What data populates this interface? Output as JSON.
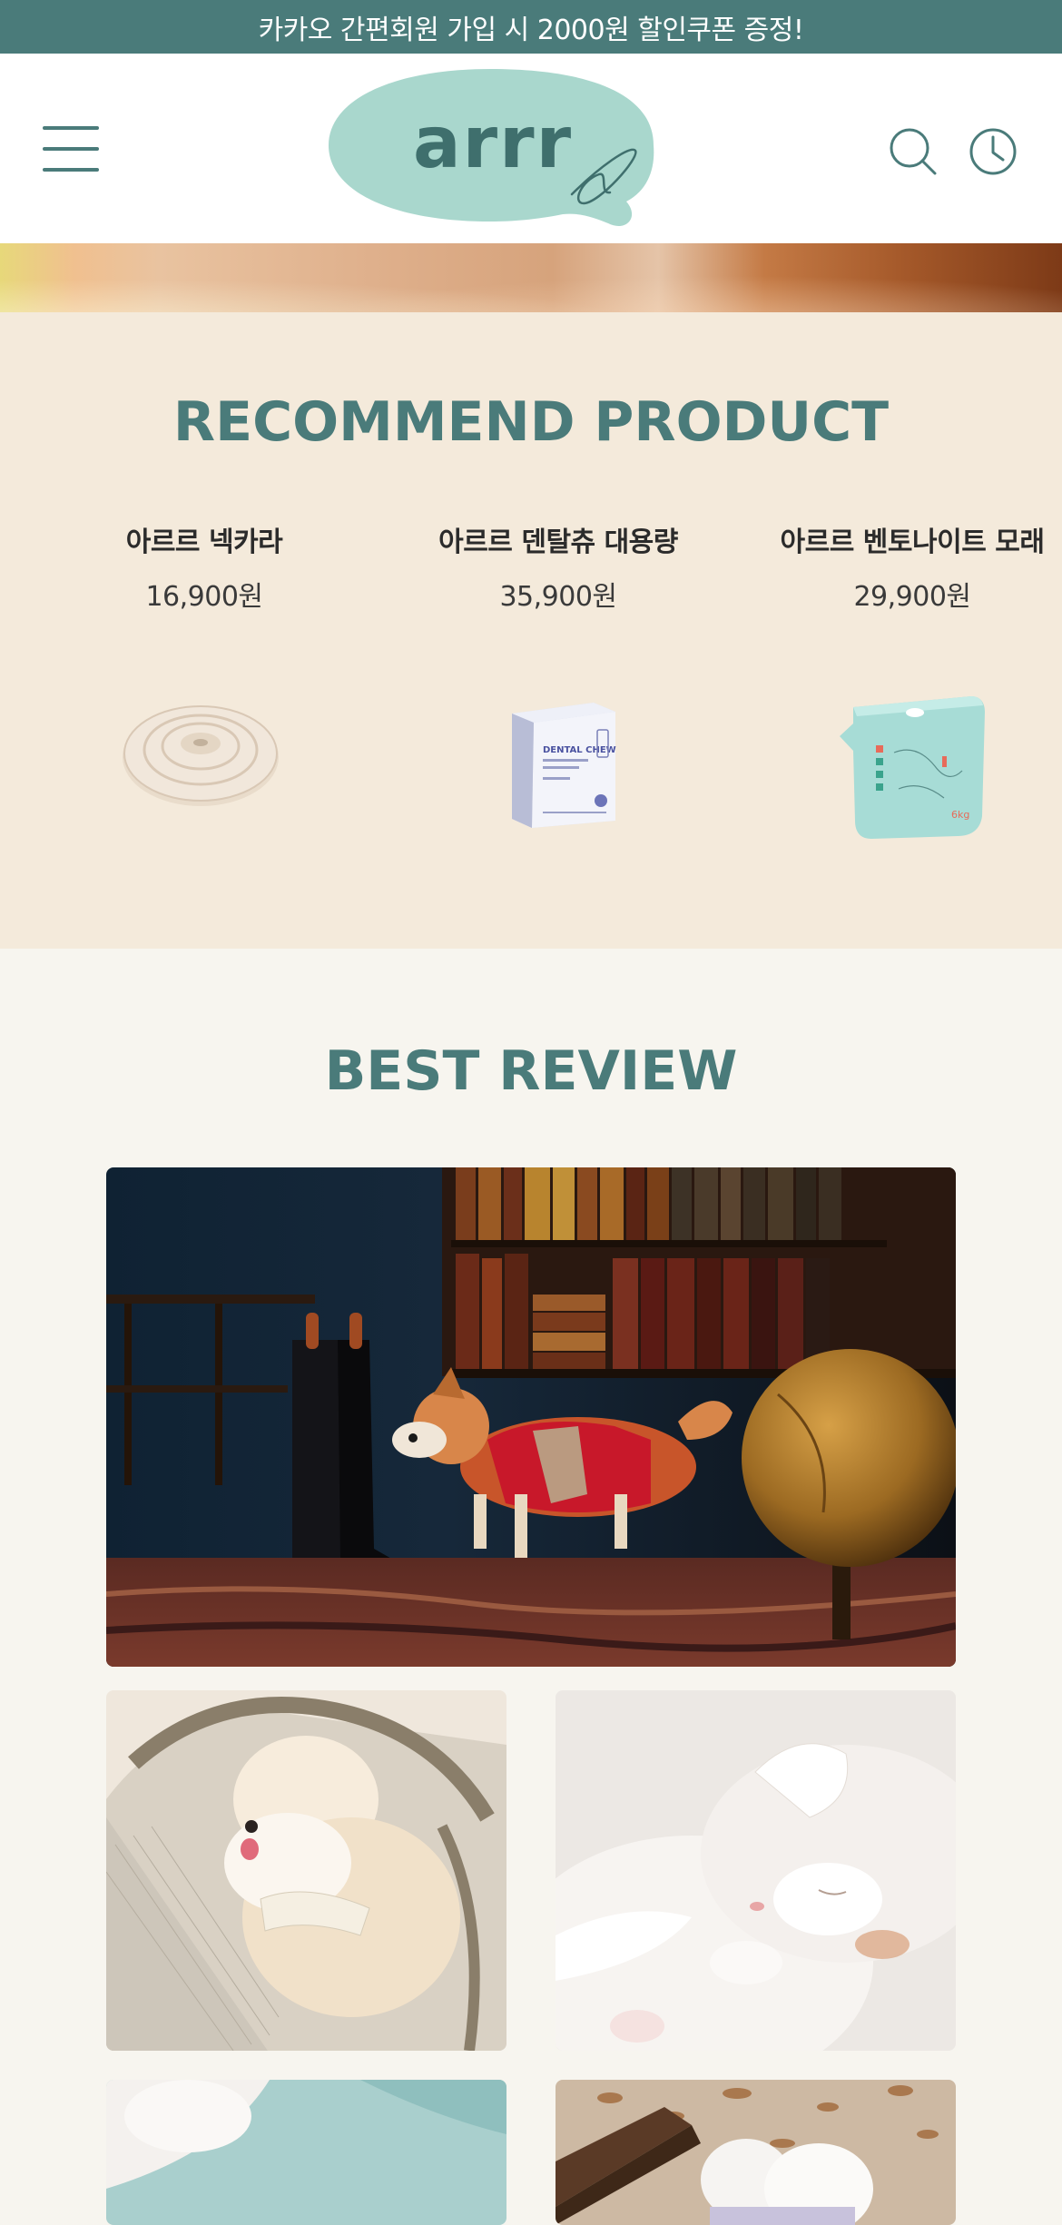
{
  "promo_bar": {
    "text": "카카오 간편회원 가입 시 2000원 할인쿠폰 증정!"
  },
  "header": {
    "logo_text": "arrr",
    "menu_icon": "hamburger-menu-icon",
    "search_icon": "search-icon",
    "recent_icon": "clock-icon"
  },
  "recommend": {
    "title": "RECOMMEND PRODUCT",
    "products": [
      {
        "name": "아르르 넥카라",
        "price": "16,900원"
      },
      {
        "name": "아르르 덴탈츄 대용량",
        "price": "35,900원"
      },
      {
        "name": "아르르 벤토나이트 모래",
        "price": "29,900원"
      }
    ],
    "dental_box": {
      "brand": "DENTAL CHEW"
    }
  },
  "best_review": {
    "title": "BEST REVIEW"
  },
  "colors": {
    "accent": "#4a7b7a",
    "logo_bg": "#a9d7cd",
    "recommend_bg": "#f4eadb",
    "page_bg": "#f7f5ef"
  }
}
